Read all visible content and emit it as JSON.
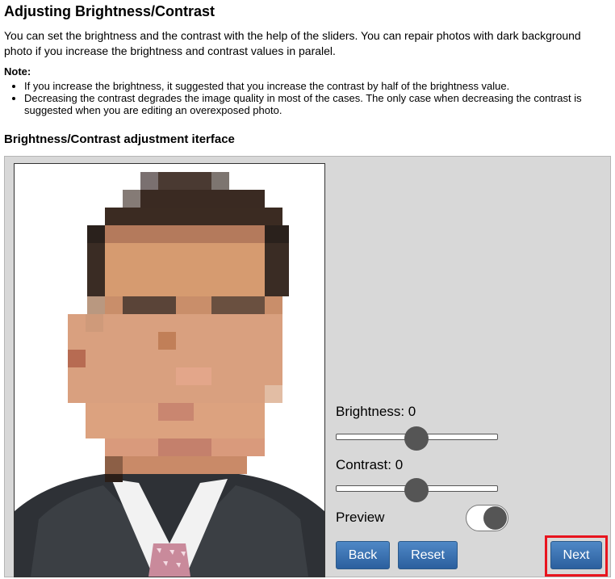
{
  "page": {
    "title": "Adjusting Brightness/Contrast",
    "intro": "You can set the brightness and the contrast with the help of the sliders. You can repair photos with dark background photo if you increase the brightness and contrast values in paralel.",
    "note_label": "Note:",
    "notes": [
      "If you increase the brightness, it suggested that you increase the contrast by half of the brightness value.",
      "Decreasing the contrast degrades the image quality in most of the cases. The only case when decreasing the contrast is suggested when you are editing an overexposed photo."
    ],
    "section_title": "Brightness/Contrast adjustment iterface"
  },
  "controls": {
    "brightness_label": "Brightness: 0",
    "brightness_value": 0,
    "contrast_label": "Contrast: 0",
    "contrast_value": 0,
    "preview_label": "Preview",
    "preview_on": true
  },
  "buttons": {
    "back": "Back",
    "reset": "Reset",
    "next": "Next"
  },
  "colors": {
    "button_blue": "#3a72b3",
    "panel_gray": "#d8d8d8",
    "highlight_red": "#e8141e"
  }
}
